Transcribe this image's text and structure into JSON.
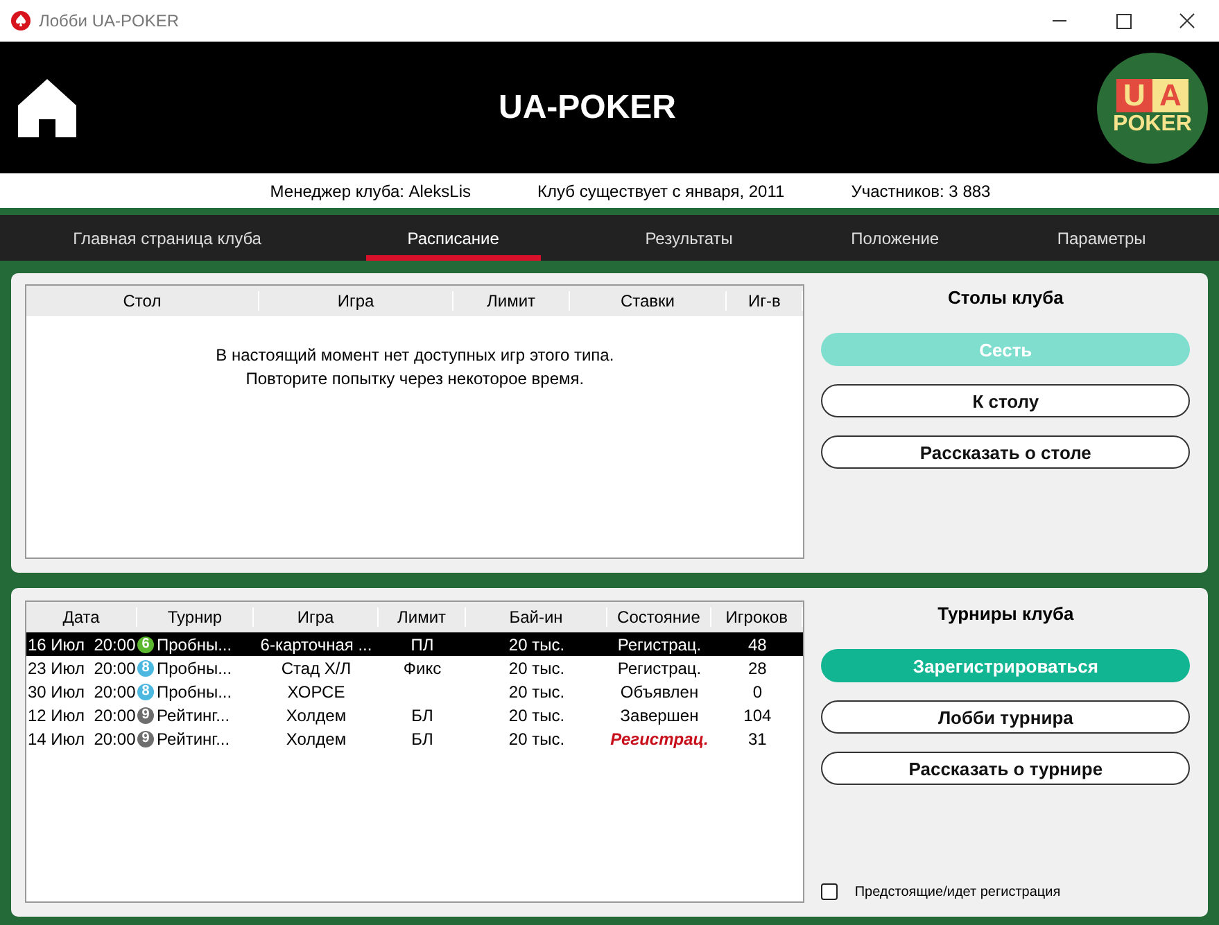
{
  "window": {
    "title": "Лобби UA-POKER"
  },
  "header": {
    "title": "UA-POKER",
    "logo_top_left": "U",
    "logo_top_right": "A",
    "logo_bottom": "POKER"
  },
  "info": [
    "Менеджер клуба: AleksLis",
    "Клуб существует с января, 2011",
    "Участников: 3 883"
  ],
  "tabs": [
    {
      "label": "Главная страница клуба",
      "selected": false
    },
    {
      "label": "Расписание",
      "selected": true
    },
    {
      "label": "Результаты",
      "selected": false
    },
    {
      "label": "Положение",
      "selected": false
    },
    {
      "label": "Параметры",
      "selected": false
    }
  ],
  "tables": {
    "columns": [
      "Стол",
      "Игра",
      "Лимит",
      "Ставки",
      "Иг-в"
    ],
    "empty_message": [
      "В настоящий момент нет доступных игр этого типа.",
      "Повторите попытку через некоторое время."
    ],
    "side_title": "Столы клуба",
    "buttons": [
      {
        "label": "Сесть",
        "kind": "primary",
        "disabled": true
      },
      {
        "label": "К столу",
        "kind": "outline",
        "disabled": false
      },
      {
        "label": "Рассказать о столе",
        "kind": "outline",
        "disabled": false
      }
    ]
  },
  "tournaments": {
    "columns": [
      "Дата",
      "Турнир",
      "Игра",
      "Лимит",
      "Бай-ин",
      "Состояние",
      "Игроков"
    ],
    "rows": [
      {
        "date": "16 Июл",
        "time": "20:00",
        "badge": "6",
        "color": "#5cb82e",
        "name": "Пробны...",
        "game": "6-карточная ...",
        "limit": "ПЛ",
        "buyin": "20 тыс.",
        "status": "Регистрац.",
        "alert": false,
        "players": "48",
        "selected": true
      },
      {
        "date": "23 Июл",
        "time": "20:00",
        "badge": "8",
        "color": "#4db8e0",
        "name": "Пробны...",
        "game": "Стад Х/Л",
        "limit": "Фикс",
        "buyin": "20 тыс.",
        "status": "Регистрац.",
        "alert": false,
        "players": "28",
        "selected": false
      },
      {
        "date": "30 Июл",
        "time": "20:00",
        "badge": "8",
        "color": "#4db8e0",
        "name": "Пробны...",
        "game": "ХОРСЕ",
        "limit": "",
        "buyin": "20 тыс.",
        "status": "Объявлен",
        "alert": false,
        "players": "0",
        "selected": false
      },
      {
        "date": "12 Июл",
        "time": "20:00",
        "badge": "9",
        "color": "#6e6e6e",
        "name": "Рейтинг...",
        "game": "Холдем",
        "limit": "БЛ",
        "buyin": "20 тыс.",
        "status": "Завершен",
        "alert": false,
        "players": "104",
        "selected": false
      },
      {
        "date": "14 Июл",
        "time": "20:00",
        "badge": "9",
        "color": "#6e6e6e",
        "name": "Рейтинг...",
        "game": "Холдем",
        "limit": "БЛ",
        "buyin": "20 тыс.",
        "status": "Регистрац.",
        "alert": true,
        "players": "31",
        "selected": false
      }
    ],
    "side_title": "Турниры клуба",
    "buttons": [
      {
        "label": "Зарегистрироваться",
        "kind": "primary",
        "disabled": false
      },
      {
        "label": "Лобби турнира",
        "kind": "outline",
        "disabled": false
      },
      {
        "label": "Рассказать о турнире",
        "kind": "outline",
        "disabled": false
      }
    ],
    "filter": {
      "label": "Предстоящие/идет регистрация",
      "checked": false
    }
  }
}
